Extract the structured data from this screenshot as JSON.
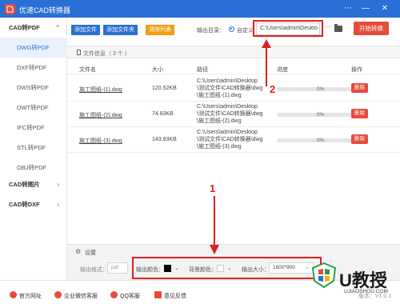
{
  "app": {
    "title": "优速CAD转换器",
    "win_controls": [
      "⋯",
      "—",
      "✕"
    ]
  },
  "sidebar": {
    "groups": [
      {
        "label": "CAD转PDF",
        "arrow": "^"
      },
      {
        "label": "CAD转图片",
        "arrow": "›"
      },
      {
        "label": "CAD转DXF",
        "arrow": "›"
      }
    ],
    "items": [
      "DWG转PDF",
      "DXF转PDF",
      "DWS转PDF",
      "DWT转PDF",
      "IFC转PDF",
      "STL转PDF",
      "OBJ转PDF"
    ]
  },
  "toolbar": {
    "add_file": "添加文件",
    "add_folder": "添加文件夹",
    "clear_list": "清除列表",
    "output_dir_label": "输出目录：",
    "custom_label": "自定义",
    "output_path": "C:\\Users\\admin\\Deskto",
    "more": "···",
    "start": "开始转换"
  },
  "file_info": {
    "title": "文件信息（ 3 个 ）"
  },
  "table": {
    "headers": [
      "文件名",
      "大小",
      "路径",
      "进度",
      "操作"
    ],
    "rows": [
      {
        "name": "施工图纸-(1).dwg",
        "size": "120.52KB",
        "path": [
          "C:\\Users\\admin\\Desktop",
          "\\测试文件\\CAD转换器\\dwg",
          "\\施工图纸-(1).dwg"
        ],
        "progress": "0%",
        "action": "删除"
      },
      {
        "name": "施工图纸-(2).dwg",
        "size": "74.83KB",
        "path": [
          "C:\\Users\\admin\\Desktop",
          "\\测试文件\\CAD转换器\\dwg",
          "\\施工图纸-(2).dwg"
        ],
        "progress": "0%",
        "action": "删除"
      },
      {
        "name": "施工图纸-(3).dwg",
        "size": "143.93KB",
        "path": [
          "C:\\Users\\admin\\Desktop",
          "\\测试文件\\CAD转换器\\dwg",
          "\\施工图纸-(3).dwg"
        ],
        "progress": "0%",
        "action": "删除"
      }
    ]
  },
  "settings": {
    "title": "设置",
    "format_label": "输出格式：",
    "format_value": "pdf",
    "color_label": "输出颜色：",
    "color_value": "#000000",
    "bg_label": "背景颜色：",
    "bg_value": "#ffffff",
    "size_label": "输出大小：",
    "size_value": "1600*900"
  },
  "footer": {
    "items": [
      "官方网址",
      "企业微信客服",
      "QQ客服",
      "意见反馈"
    ],
    "version": "版本：V1.0.1"
  },
  "annotations": {
    "one": "1",
    "two": "2"
  },
  "watermark": {
    "text": "U教授",
    "sub": "UJIAOSHOU.COM"
  },
  "colors": {
    "accent": "#2a6fd6",
    "danger": "#e64c3c",
    "annotation": "#e02020",
    "clear_btn": "#f39c12"
  }
}
